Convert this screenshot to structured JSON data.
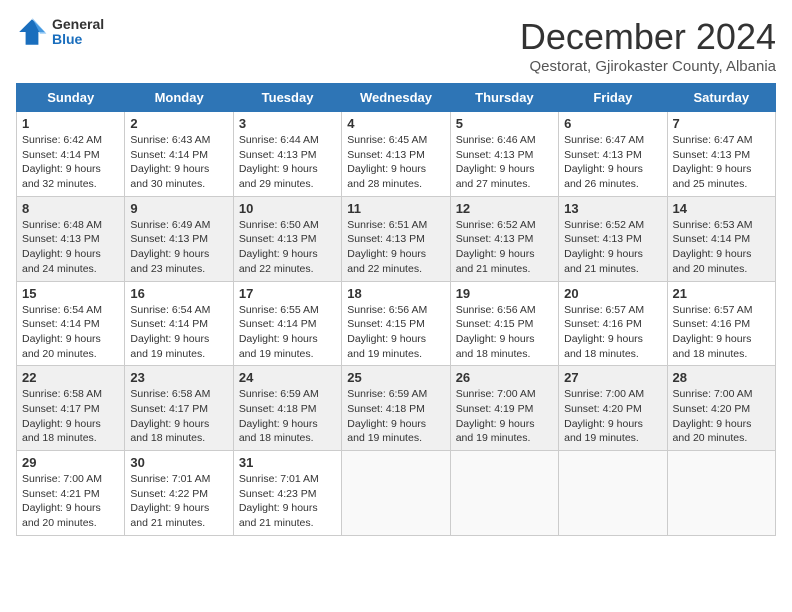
{
  "logo": {
    "general": "General",
    "blue": "Blue"
  },
  "title": "December 2024",
  "subtitle": "Qestorat, Gjirokaster County, Albania",
  "headers": [
    "Sunday",
    "Monday",
    "Tuesday",
    "Wednesday",
    "Thursday",
    "Friday",
    "Saturday"
  ],
  "weeks": [
    [
      {
        "day": "1",
        "sunrise": "6:42 AM",
        "sunset": "4:14 PM",
        "daylight": "9 hours and 32 minutes."
      },
      {
        "day": "2",
        "sunrise": "6:43 AM",
        "sunset": "4:14 PM",
        "daylight": "9 hours and 30 minutes."
      },
      {
        "day": "3",
        "sunrise": "6:44 AM",
        "sunset": "4:13 PM",
        "daylight": "9 hours and 29 minutes."
      },
      {
        "day": "4",
        "sunrise": "6:45 AM",
        "sunset": "4:13 PM",
        "daylight": "9 hours and 28 minutes."
      },
      {
        "day": "5",
        "sunrise": "6:46 AM",
        "sunset": "4:13 PM",
        "daylight": "9 hours and 27 minutes."
      },
      {
        "day": "6",
        "sunrise": "6:47 AM",
        "sunset": "4:13 PM",
        "daylight": "9 hours and 26 minutes."
      },
      {
        "day": "7",
        "sunrise": "6:47 AM",
        "sunset": "4:13 PM",
        "daylight": "9 hours and 25 minutes."
      }
    ],
    [
      {
        "day": "8",
        "sunrise": "6:48 AM",
        "sunset": "4:13 PM",
        "daylight": "9 hours and 24 minutes."
      },
      {
        "day": "9",
        "sunrise": "6:49 AM",
        "sunset": "4:13 PM",
        "daylight": "9 hours and 23 minutes."
      },
      {
        "day": "10",
        "sunrise": "6:50 AM",
        "sunset": "4:13 PM",
        "daylight": "9 hours and 22 minutes."
      },
      {
        "day": "11",
        "sunrise": "6:51 AM",
        "sunset": "4:13 PM",
        "daylight": "9 hours and 22 minutes."
      },
      {
        "day": "12",
        "sunrise": "6:52 AM",
        "sunset": "4:13 PM",
        "daylight": "9 hours and 21 minutes."
      },
      {
        "day": "13",
        "sunrise": "6:52 AM",
        "sunset": "4:13 PM",
        "daylight": "9 hours and 21 minutes."
      },
      {
        "day": "14",
        "sunrise": "6:53 AM",
        "sunset": "4:14 PM",
        "daylight": "9 hours and 20 minutes."
      }
    ],
    [
      {
        "day": "15",
        "sunrise": "6:54 AM",
        "sunset": "4:14 PM",
        "daylight": "9 hours and 20 minutes."
      },
      {
        "day": "16",
        "sunrise": "6:54 AM",
        "sunset": "4:14 PM",
        "daylight": "9 hours and 19 minutes."
      },
      {
        "day": "17",
        "sunrise": "6:55 AM",
        "sunset": "4:14 PM",
        "daylight": "9 hours and 19 minutes."
      },
      {
        "day": "18",
        "sunrise": "6:56 AM",
        "sunset": "4:15 PM",
        "daylight": "9 hours and 19 minutes."
      },
      {
        "day": "19",
        "sunrise": "6:56 AM",
        "sunset": "4:15 PM",
        "daylight": "9 hours and 18 minutes."
      },
      {
        "day": "20",
        "sunrise": "6:57 AM",
        "sunset": "4:16 PM",
        "daylight": "9 hours and 18 minutes."
      },
      {
        "day": "21",
        "sunrise": "6:57 AM",
        "sunset": "4:16 PM",
        "daylight": "9 hours and 18 minutes."
      }
    ],
    [
      {
        "day": "22",
        "sunrise": "6:58 AM",
        "sunset": "4:17 PM",
        "daylight": "9 hours and 18 minutes."
      },
      {
        "day": "23",
        "sunrise": "6:58 AM",
        "sunset": "4:17 PM",
        "daylight": "9 hours and 18 minutes."
      },
      {
        "day": "24",
        "sunrise": "6:59 AM",
        "sunset": "4:18 PM",
        "daylight": "9 hours and 18 minutes."
      },
      {
        "day": "25",
        "sunrise": "6:59 AM",
        "sunset": "4:18 PM",
        "daylight": "9 hours and 19 minutes."
      },
      {
        "day": "26",
        "sunrise": "7:00 AM",
        "sunset": "4:19 PM",
        "daylight": "9 hours and 19 minutes."
      },
      {
        "day": "27",
        "sunrise": "7:00 AM",
        "sunset": "4:20 PM",
        "daylight": "9 hours and 19 minutes."
      },
      {
        "day": "28",
        "sunrise": "7:00 AM",
        "sunset": "4:20 PM",
        "daylight": "9 hours and 20 minutes."
      }
    ],
    [
      {
        "day": "29",
        "sunrise": "7:00 AM",
        "sunset": "4:21 PM",
        "daylight": "9 hours and 20 minutes."
      },
      {
        "day": "30",
        "sunrise": "7:01 AM",
        "sunset": "4:22 PM",
        "daylight": "9 hours and 21 minutes."
      },
      {
        "day": "31",
        "sunrise": "7:01 AM",
        "sunset": "4:23 PM",
        "daylight": "9 hours and 21 minutes."
      },
      null,
      null,
      null,
      null
    ]
  ],
  "labels": {
    "sunrise": "Sunrise:",
    "sunset": "Sunset:",
    "daylight": "Daylight:"
  }
}
